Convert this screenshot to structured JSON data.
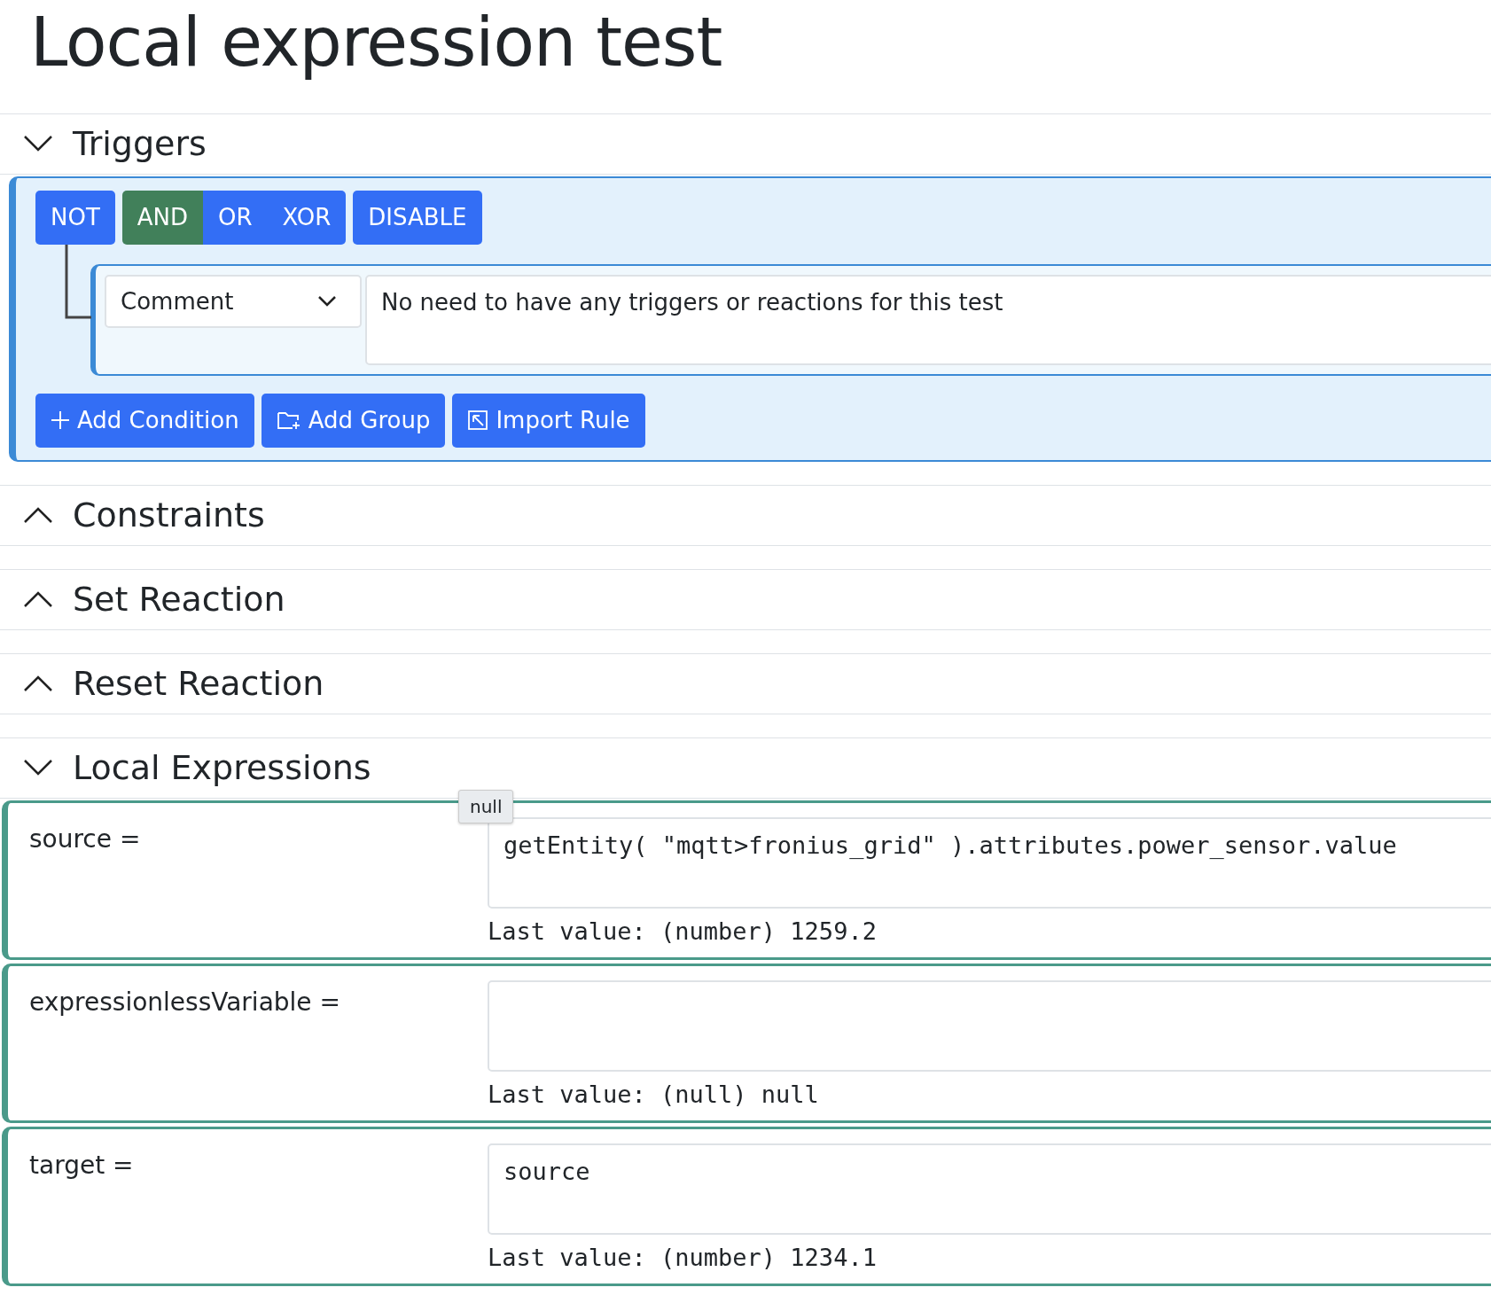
{
  "title": "Local expression test",
  "sections": [
    {
      "label": "Triggers",
      "expanded": true,
      "kind": "triggers"
    },
    {
      "label": "Constraints",
      "expanded": false
    },
    {
      "label": "Set Reaction",
      "expanded": false
    },
    {
      "label": "Reset Reaction",
      "expanded": false
    },
    {
      "label": "Local Expressions",
      "expanded": true,
      "kind": "expressions"
    }
  ],
  "triggers": {
    "not": {
      "label": "NOT",
      "selected": false
    },
    "operators": [
      {
        "label": "AND",
        "selected": true
      },
      {
        "label": "OR",
        "selected": false
      },
      {
        "label": "XOR",
        "selected": false
      }
    ],
    "disable": "DISABLE",
    "conditions": [
      {
        "type": "Comment",
        "text": "No need to have any triggers or reactions for this test"
      }
    ],
    "actions": [
      {
        "kind": "plus",
        "label": "Add Condition"
      },
      {
        "kind": "folder",
        "label": "Add Group"
      },
      {
        "kind": "import",
        "label": "Import Rule"
      }
    ]
  },
  "tooltip": "null",
  "expressions": [
    {
      "name": "source =",
      "expression": "getEntity( \"mqtt>fronius_grid\" ).attributes.power_sensor.value",
      "last_label": "Last value:",
      "last_value": "(number) 1259.2"
    },
    {
      "name": "expressionlessVariable =",
      "last_label": "Last value:",
      "last_value": "(null) null"
    },
    {
      "name": "target =",
      "expression": "source",
      "last_label": "Last value:",
      "last_value": "(number) 1234.1"
    }
  ]
}
